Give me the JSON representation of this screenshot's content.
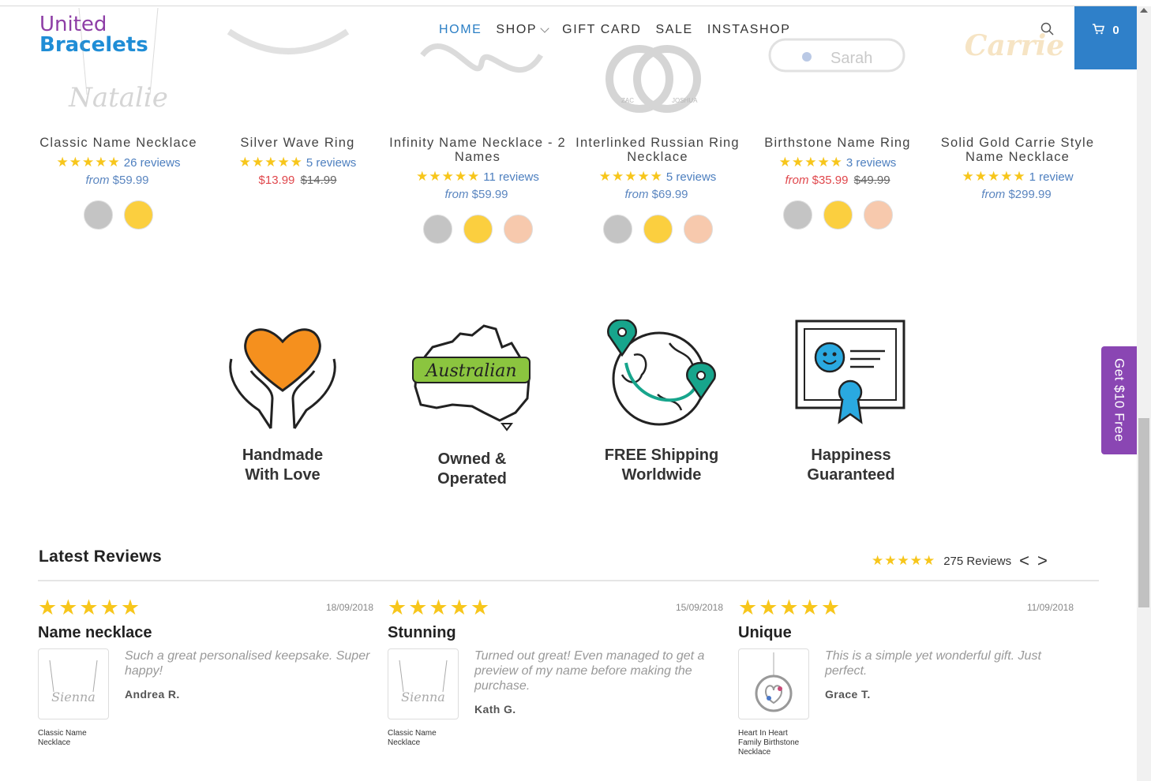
{
  "header": {
    "logo_line1": "United",
    "logo_line2": "Bracelets",
    "nav": [
      "HOME",
      "SHOP",
      "GIFT CARD",
      "SALE",
      "INSTASHOP"
    ],
    "cart_count": "0"
  },
  "products": [
    {
      "title": "Classic Name Necklace",
      "stars": "★★★★★",
      "reviews": "26 reviews",
      "from": "from",
      "price": "$59.99",
      "old_price": "",
      "sale": false,
      "swatches": [
        "#c4c4c4",
        "#fbcf3f"
      ]
    },
    {
      "title": "Silver Wave Ring",
      "stars": "★★★★★",
      "reviews": "5 reviews",
      "from": "",
      "price": "$13.99",
      "old_price": "$14.99",
      "sale": true,
      "swatches": []
    },
    {
      "title": "Infinity Name Necklace - 2 Names",
      "stars": "★★★★★",
      "reviews": "11 reviews",
      "from": "from",
      "price": "$59.99",
      "old_price": "",
      "sale": false,
      "swatches": [
        "#c4c4c4",
        "#fbcf3f",
        "#f7c9ad"
      ]
    },
    {
      "title": "Interlinked Russian Ring Necklace",
      "stars": "★★★★★",
      "reviews": "5 reviews",
      "from": "from",
      "price": "$69.99",
      "old_price": "",
      "sale": false,
      "swatches": [
        "#c4c4c4",
        "#fbcf3f",
        "#f7c9ad"
      ]
    },
    {
      "title": "Birthstone Name Ring",
      "stars": "★★★★★",
      "reviews": "3 reviews",
      "from": "from",
      "price": "$35.99",
      "old_price": "$49.99",
      "sale": true,
      "swatches": [
        "#c4c4c4",
        "#fbcf3f",
        "#f7c9ad"
      ]
    },
    {
      "title": "Solid Gold Carrie Style Name Necklace",
      "stars": "★★★★★",
      "reviews": "1 review",
      "from": "from",
      "price": "$299.99",
      "old_price": "",
      "sale": false,
      "swatches": []
    }
  ],
  "product_image_text": {
    "p1": "Natalie",
    "p5": "Sarah",
    "p6": "Carrie",
    "p4a": "ZAC",
    "p4b": "JOSHUA"
  },
  "features": [
    {
      "line1": "Handmade",
      "line2": "With Love",
      "icon": "heart-hands-icon"
    },
    {
      "line1": "Owned &",
      "line2": "Operated",
      "icon": "australia-map-icon"
    },
    {
      "line1": "FREE Shipping",
      "line2": "Worldwide",
      "icon": "globe-shipping-icon"
    },
    {
      "line1": "Happiness",
      "line2": "Guaranteed",
      "icon": "certificate-icon"
    }
  ],
  "feature_badge_text": "Australian",
  "reviews_section": {
    "title": "Latest Reviews",
    "summary_stars": "★★★★★",
    "summary_count": "275 Reviews",
    "prev": "<",
    "next": ">"
  },
  "reviews": [
    {
      "stars": "★★★★★",
      "date": "18/09/2018",
      "title": "Name necklace",
      "text": "Such a great personalised keepsake. Super happy!",
      "author": "Andrea R.",
      "product": "Classic Name Necklace",
      "thumb_text": "Sienna"
    },
    {
      "stars": "★★★★★",
      "date": "15/09/2018",
      "title": "Stunning",
      "text": "Turned out great! Even managed to get a preview of my name before making the purchase.",
      "author": "Kath G.",
      "product": "Classic Name Necklace",
      "thumb_text": "Sienna"
    },
    {
      "stars": "★★★★★",
      "date": "11/09/2018",
      "title": "Unique",
      "text": "This is a simple yet wonderful gift. Just perfect.",
      "author": "Grace T.",
      "product": "Heart In Heart Family Birthstone Necklace",
      "thumb_text": ""
    }
  ],
  "promo": {
    "label": "Get $10 Free"
  },
  "colors": {
    "accent": "#2f80c9",
    "logo_purple": "#8e3ea6",
    "logo_blue": "#1f8dd6",
    "star": "#f7c61b",
    "sale": "#e0474c",
    "promo": "#8a46b3"
  }
}
